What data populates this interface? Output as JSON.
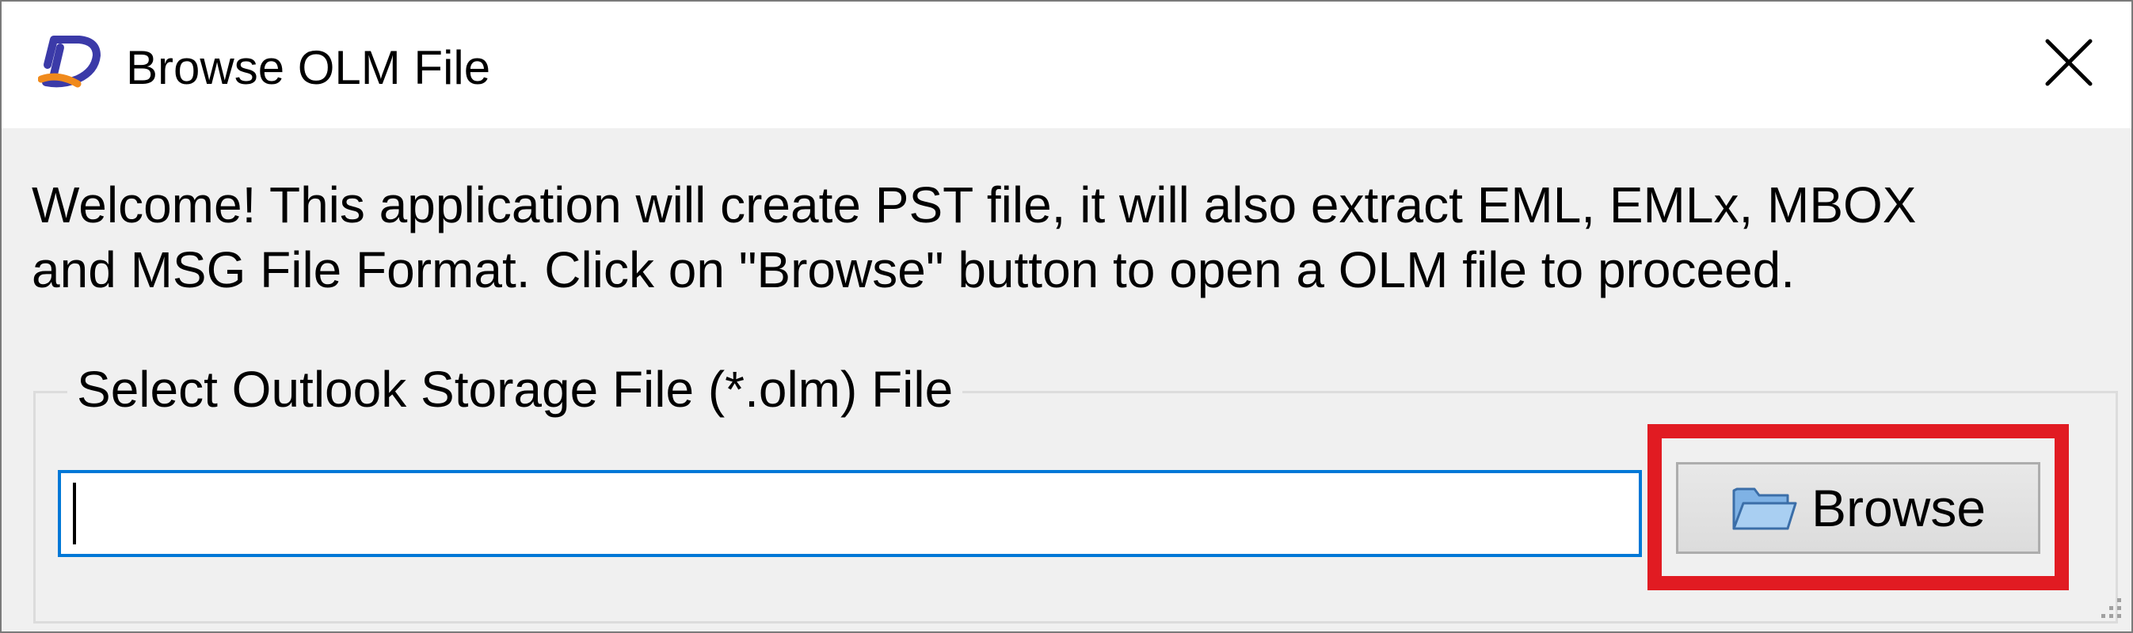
{
  "window": {
    "title": "Browse OLM File",
    "app_icon": "app-logo-icon",
    "close_icon": "close-icon"
  },
  "intro": {
    "line1": "Welcome! This application will create PST file, it will also extract EML, EMLx,  MBOX",
    "line2": "and MSG  File Format. Click on \"Browse\" button to open a OLM file to proceed."
  },
  "file_group": {
    "label": "Select Outlook Storage File (*.olm) File",
    "input_value": "",
    "browse_label": "Browse",
    "browse_icon": "folder-open-icon"
  },
  "colors": {
    "highlight": "#e11b22",
    "input_focus": "#0078d7",
    "logo_blue": "#3b3aa8",
    "logo_orange": "#f08a1c"
  }
}
